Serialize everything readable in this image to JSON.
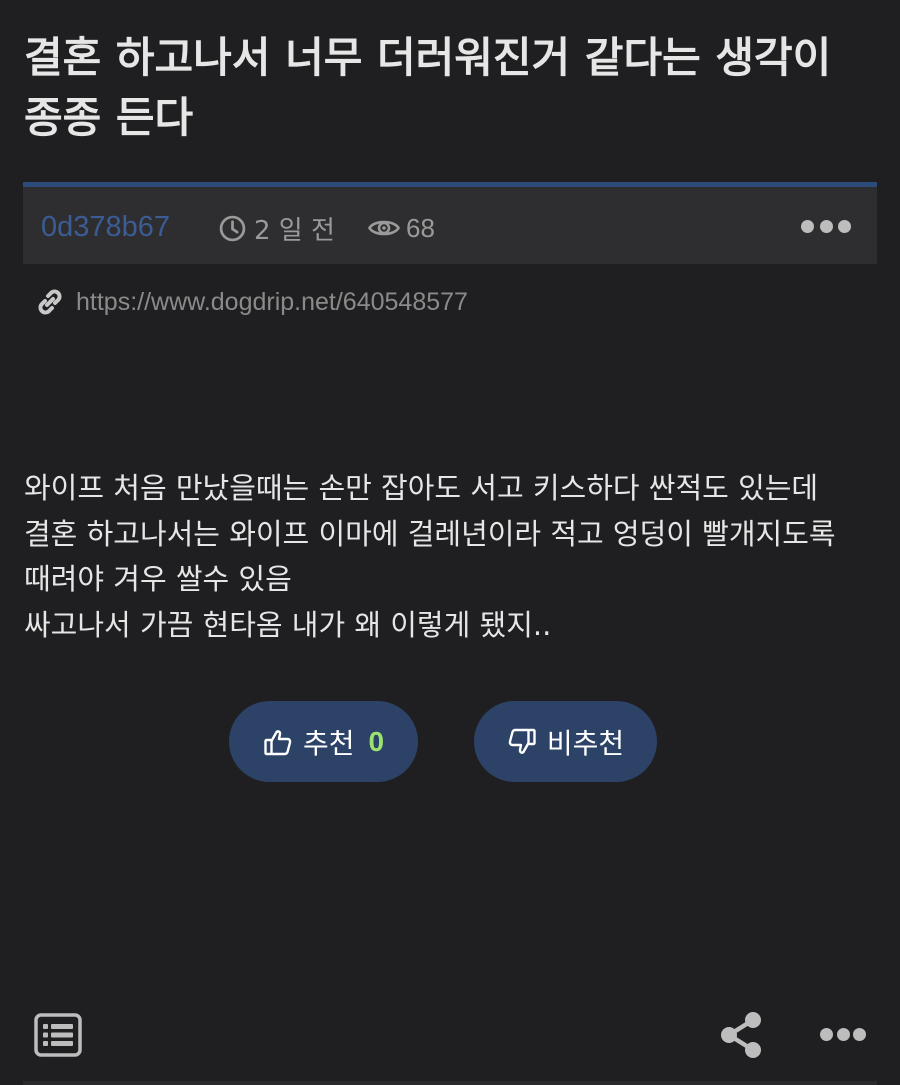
{
  "post": {
    "title": "결혼 하고나서 너무 더러워진거 같다는 생각이 종종 든다",
    "author": "0d378b67",
    "time": "2 일 전",
    "views": "68",
    "url": "https://www.dogdrip.net/640548577",
    "body_lines": [
      "와이프 처음 만났을때는 손만 잡아도 서고 키스하다 싼적도 있는데",
      "결혼 하고나서는 와이프 이마에 걸레년이라 적고 엉덩이 빨개지도록",
      "때려야 겨우 쌀수 있음",
      "싸고나서 가끔 현타옴 내가 왜 이렇게 됐지.."
    ]
  },
  "votes": {
    "up_label": "추천",
    "up_count": "0",
    "down_label": "비추천"
  },
  "icons": {
    "clock": "clock-icon",
    "eye": "eye-icon",
    "link": "link-icon",
    "more": "more-dots-icon",
    "thumbs_up": "thumbs-up-icon",
    "thumbs_down": "thumbs-down-icon",
    "list": "list-icon",
    "share": "share-icon"
  },
  "colors": {
    "background": "#1f1f21",
    "meta_bar": "#2e2e30",
    "accent_blue": "#2c4a7a",
    "author": "#3b5c94",
    "vote_button": "#2c4266",
    "vote_count": "#9be36e"
  }
}
